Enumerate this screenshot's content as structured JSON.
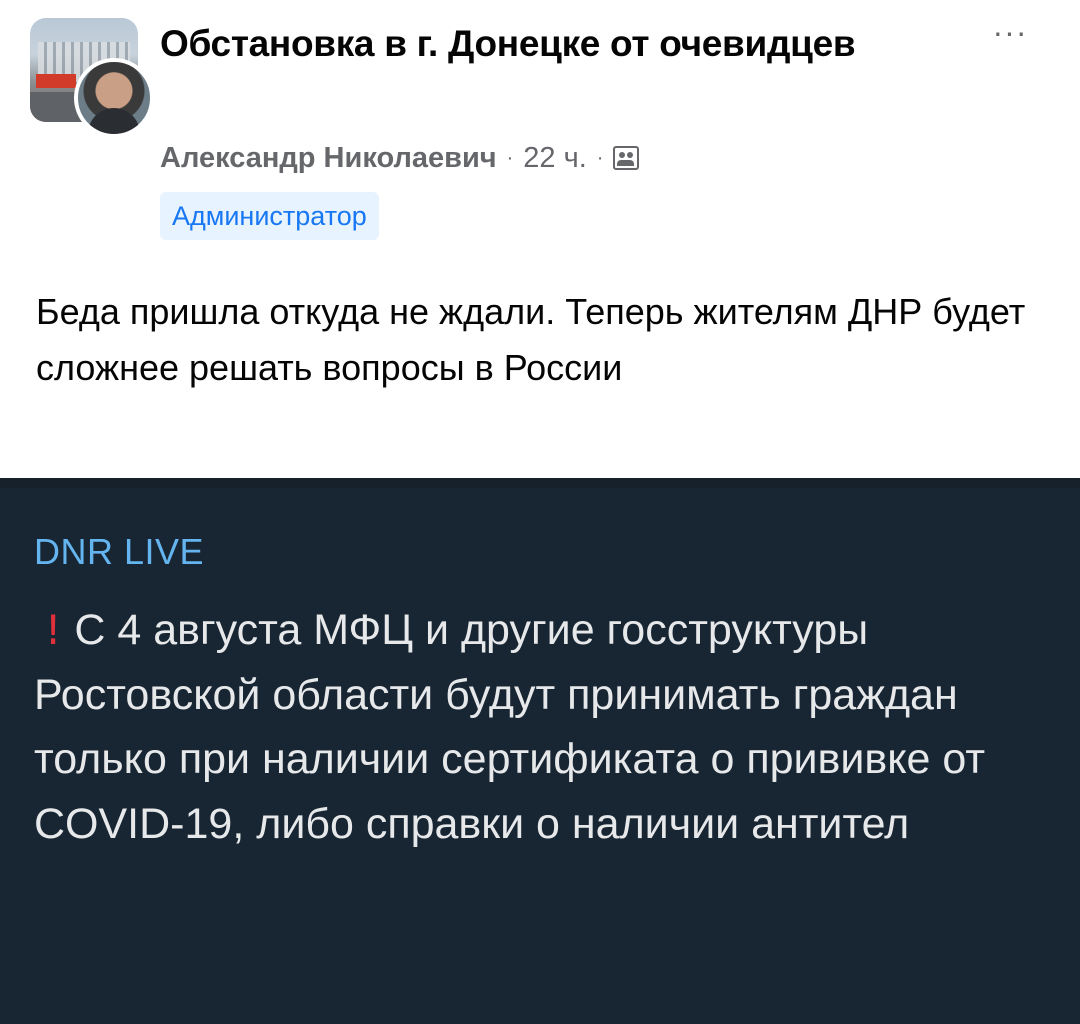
{
  "post": {
    "group_name": "Обстановка в г. Донецке от очевидцев",
    "more_label": "···",
    "author": "Александр Николаевич",
    "separator": "·",
    "time": "22 ч.",
    "audience_icon": "group-audience-icon",
    "role_badge": "Администратор",
    "text": "Беда пришла откуда не ждали. Теперь жителям ДНР будет сложнее решать вопросы в России"
  },
  "embed": {
    "channel_name": "DNR LIVE",
    "alert_icon": "!",
    "alert_icon_name": "red-exclamation-icon",
    "message": "С 4 августа МФЦ и другие госструктуры Ростовской области будут принимать граждан только при наличии сертификата о прививке от COVID-19, либо справки о наличии антител"
  },
  "colors": {
    "text_primary": "#050505",
    "text_secondary": "#65676b",
    "badge_bg": "#e7f3ff",
    "badge_text": "#1877f2",
    "embed_bg": "#182533",
    "channel_name": "#64b5ef",
    "message_text": "#e6e8ea",
    "alert": "#e0303b"
  }
}
